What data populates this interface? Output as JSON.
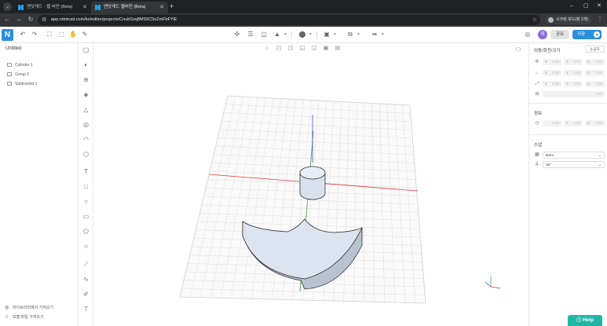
{
  "browser": {
    "tabs": [
      {
        "title": "엔닷캐드 - 웹 버전 (Beta)",
        "active": false
      },
      {
        "title": "엔닷캐드 웹버전 (Beta)",
        "active": true
      }
    ],
    "new_tab": "+",
    "url": "app.ndotcad.com/ko/editor/projects/CnubSzq8MS5C5oZmFbFYiE",
    "incognito_label": "시크릿 모드(창 2개)",
    "window_controls": [
      "–",
      "▢",
      "✕"
    ]
  },
  "toolbar": {
    "logo": "N",
    "avatar_initial": "육",
    "share_label": "공유",
    "save_label": "저장"
  },
  "left_panel": {
    "document_title": "Untitled",
    "tree": [
      {
        "label": "Cylinder 1"
      },
      {
        "label": "Group 1"
      },
      {
        "label": "Subtracted 1"
      }
    ],
    "import_library": "라이브러리에서 가져오기",
    "import_model": "모델 파일 가져오기"
  },
  "right_panel": {
    "transform_title": "이동/회전/크기",
    "ruler_label": "눈금자",
    "position": {
      "x": "0.00",
      "y": "0.00",
      "z": "0.00"
    },
    "rotation": {
      "x": "0.00",
      "y": "0.00",
      "z": "0.00"
    },
    "scale": {
      "x": "0.00",
      "y": "0.00",
      "z": "0.00"
    },
    "extra": "0.00",
    "info_title": "정보",
    "info_xy": {
      "x": "0.00",
      "y": "0.00"
    },
    "info_z": "0.00",
    "unit_title": "스냅",
    "snap_value": "5mm",
    "angle_value": "15°"
  },
  "help_label": "Help",
  "colors": {
    "accent": "#2b8fe0",
    "help": "#1fb6a6",
    "x_axis": "#e53935",
    "y_axis": "#43a047",
    "z_axis": "#3f51e5",
    "solid": "#dbe4ef"
  }
}
